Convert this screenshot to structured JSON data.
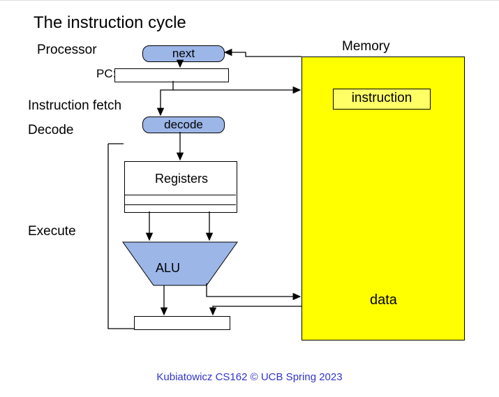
{
  "title": "The instruction cycle",
  "labels": {
    "processor": "Processor",
    "memory": "Memory",
    "fetch": "Instruction fetch",
    "decode_stage": "Decode",
    "execute": "Execute",
    "pc": "PC:",
    "registers": "Registers",
    "alu": "ALU",
    "instruction": "instruction",
    "data": "data"
  },
  "boxes": {
    "next": "next",
    "decode": "decode"
  },
  "footer": "Kubiatowicz CS162 © UCB Spring 2023"
}
